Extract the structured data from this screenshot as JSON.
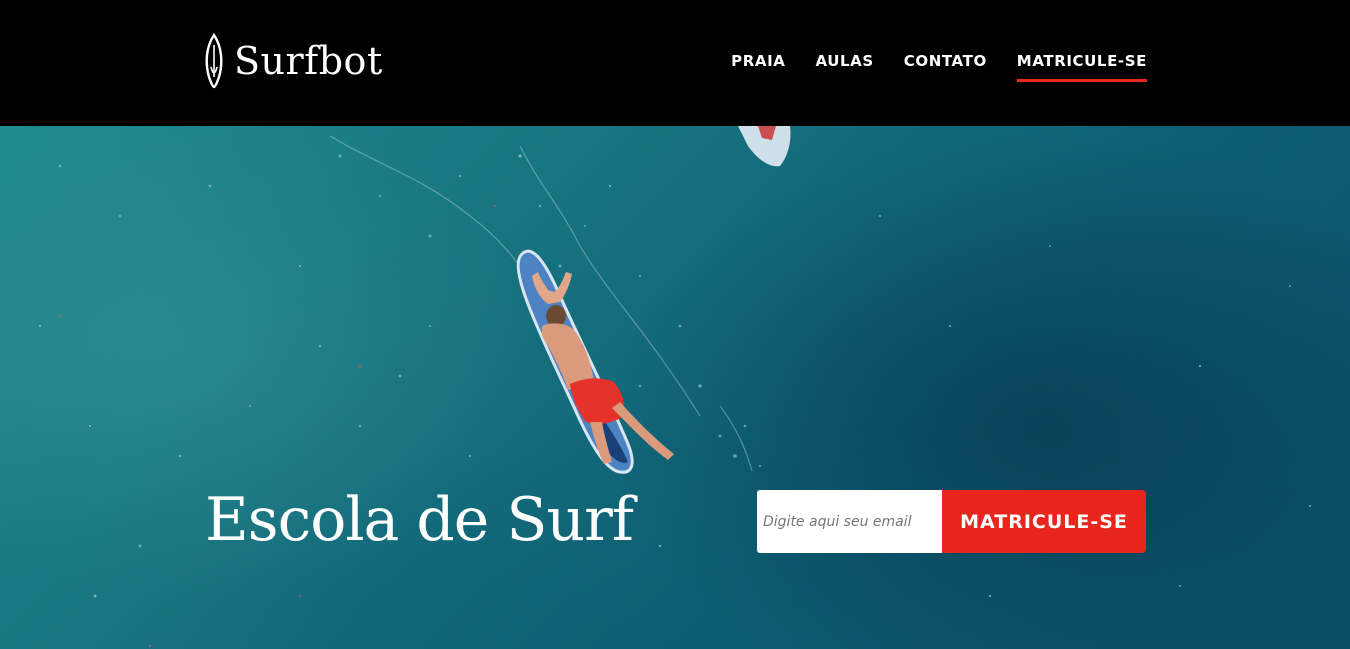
{
  "brand": {
    "name": "Surfbot",
    "icon": "surfboard-icon"
  },
  "nav": {
    "items": [
      {
        "label": "PRAIA"
      },
      {
        "label": "AULAS"
      },
      {
        "label": "CONTATO"
      },
      {
        "label": "MATRICULE-SE",
        "active": true
      }
    ]
  },
  "hero": {
    "title": "Escola de Surf",
    "background": "aerial-ocean-surfer-photo"
  },
  "signup": {
    "email_placeholder": "Digite aqui seu email",
    "email_value": "",
    "button_label": "MATRICULE-SE"
  },
  "colors": {
    "header_bg": "#000000",
    "accent": "#e8261d",
    "ocean": "#17727f",
    "text": "#ffffff"
  }
}
